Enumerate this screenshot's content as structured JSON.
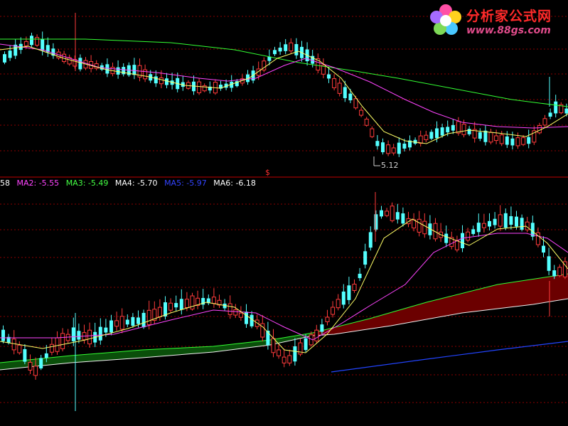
{
  "logo": {
    "brand": "分析家公式网",
    "url": "www.88gs.com",
    "icon": "flower-icon"
  },
  "panel_divider_marker": "$",
  "low_price_label": "5.12",
  "ma_legend": [
    {
      "label": "58",
      "color": "#ffffff"
    },
    {
      "label": "MA2: -5.55",
      "color": "#ff44ff"
    },
    {
      "label": "MA3: -5.49",
      "color": "#44ff44"
    },
    {
      "label": "MA4: -5.70",
      "color": "#ffffff"
    },
    {
      "label": "MA5: -5.97",
      "color": "#3344ff"
    },
    {
      "label": "MA6: -6.18",
      "color": "#ffffff"
    }
  ],
  "colors": {
    "up": "#ff3b3b",
    "down": "#54ffff",
    "ma_short": "#ffff66",
    "ma_mid": "#ff44ff",
    "ma_long": "#33ff33",
    "ma_blue": "#2244ff",
    "grid": "#8b0000",
    "band_green": "#0a4f0a",
    "band_red": "#6b0000",
    "ma_white": "#f0f0f0"
  },
  "chart_data": [
    {
      "type": "candlestick",
      "panel": "upper",
      "grid": true,
      "annotation": "5.12"
    },
    {
      "type": "candlestick",
      "panel": "lower",
      "grid": true,
      "legend": [
        "MA2: -5.55",
        "MA3: -5.49",
        "MA4: -5.70",
        "MA5: -5.97",
        "MA6: -6.18"
      ]
    }
  ]
}
